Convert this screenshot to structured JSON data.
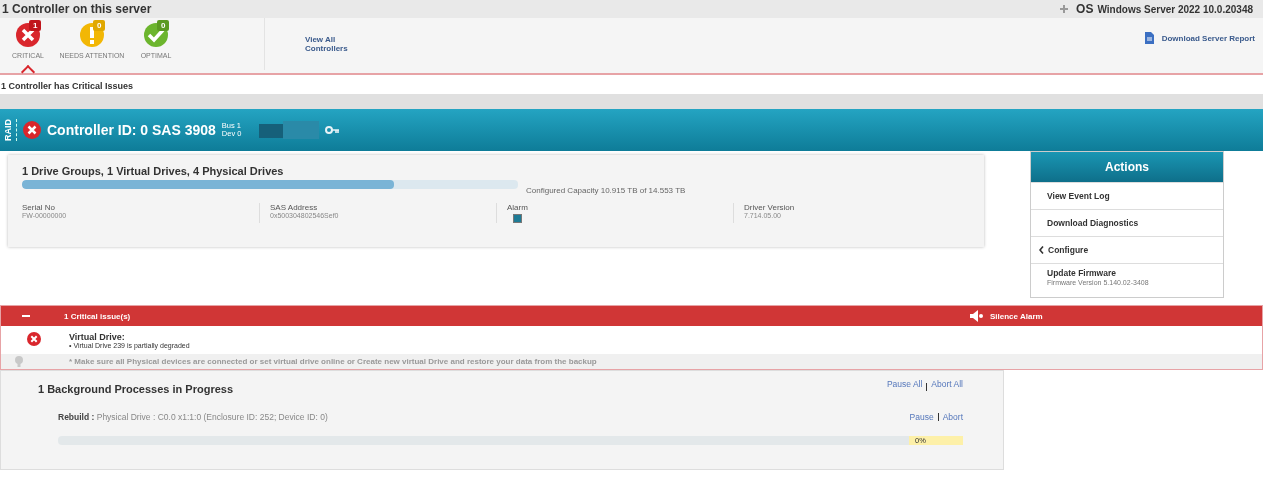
{
  "header": {
    "title": "1 Controller on this server",
    "os_label": "OS",
    "os_name": "Windows Server 2022 10.0.20348"
  },
  "status_filters": [
    {
      "kind": "critical",
      "label": "CRITICAL",
      "count": "1",
      "selected": true
    },
    {
      "kind": "attention",
      "label": "NEEDS ATTENTION",
      "count": "0",
      "selected": false
    },
    {
      "kind": "optimal",
      "label": "OPTIMAL",
      "count": "0",
      "selected": false
    }
  ],
  "view_all_link": "View All Controllers",
  "download_report_link": "Download Server Report",
  "summary": "1 Controller has Critical Issues",
  "controller": {
    "side_label": "RAID",
    "title": "Controller ID: 0 SAS 3908",
    "bus": "Bus 1",
    "dev": "Dev 0",
    "drives_summary": "1 Drive Groups, 1 Virtual Drives, 4 Physical Drives",
    "capacity": {
      "level": 0.75,
      "reading": "Configured Capacity 10.915 TB of 14.553 TB"
    },
    "properties": [
      {
        "kind": "text",
        "label": "Serial No",
        "value": "FW-00000000"
      },
      {
        "kind": "text",
        "label": "SAS Address",
        "value": "0x500304802546Sef0"
      },
      {
        "kind": "toggle",
        "label": "Alarm",
        "checked": true
      },
      {
        "kind": "text",
        "label": "Driver Version",
        "value": "7.714.05.00"
      }
    ]
  },
  "actions": {
    "title": "Actions",
    "items": [
      {
        "label": "View Event Log"
      },
      {
        "label": "Download Diagnostics"
      },
      {
        "label": "Configure",
        "expandable": true
      },
      {
        "label": "Update Firmware",
        "detail": "Firmware Version 5.140.02-3408"
      }
    ]
  },
  "issues": {
    "title": "1 Critical issue(s)",
    "silence_label": "Silence Alarm",
    "items": [
      {
        "heading": "Virtual Drive:",
        "detail": "• Virtual Drive 239 is partially degraded"
      }
    ],
    "tip": "* Make sure all Physical devices are connected or set virtual drive online or Create new virtual Drive and restore your data from the backup"
  },
  "background": {
    "title": "1 Background Processes in Progress",
    "pause_all": "Pause All",
    "abort_all": "Abort All",
    "processes": [
      {
        "name": "Rebuild :",
        "target": "Physical Drive : C0.0 x1:1:0 (Enclosure ID: 252; Device ID: 0)",
        "pause": "Pause",
        "abort": "Abort",
        "level": 0,
        "reading": "0%"
      }
    ]
  }
}
